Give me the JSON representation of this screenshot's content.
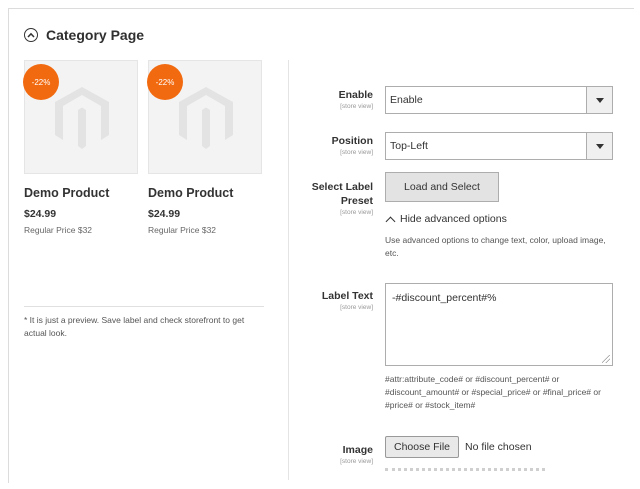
{
  "section": {
    "title": "Category Page"
  },
  "preview": {
    "products": [
      {
        "badge": "-22%",
        "name": "Demo Product",
        "price": "$24.99",
        "regular": "Regular Price $32"
      },
      {
        "badge": "-22%",
        "name": "Demo Product",
        "price": "$24.99",
        "regular": "Regular Price $32"
      }
    ],
    "note": "* It is just a preview. Save label and check storefront to get actual look."
  },
  "fields": {
    "enable": {
      "label": "Enable",
      "scope": "[store view]",
      "value": "Enable"
    },
    "position": {
      "label": "Position",
      "scope": "[store view]",
      "value": "Top-Left"
    },
    "preset": {
      "label_line1": "Select Label",
      "label_line2": "Preset",
      "scope": "[store view]",
      "button": "Load and Select"
    },
    "advanced": {
      "toggle": "Hide advanced options",
      "help": "Use advanced options to change text, color, upload image, etc."
    },
    "label_text": {
      "label": "Label Text",
      "scope": "[store view]",
      "value": "-#discount_percent#%",
      "help": "#attr:attribute_code# or #discount_percent# or #discount_amount# or #special_price# or #final_price# or #price# or #stock_item#"
    },
    "image": {
      "label": "Image",
      "scope": "[store view]",
      "button": "Choose File",
      "status": "No file chosen"
    }
  },
  "colors": {
    "badge": "#f26a10",
    "border": "#adadad"
  }
}
